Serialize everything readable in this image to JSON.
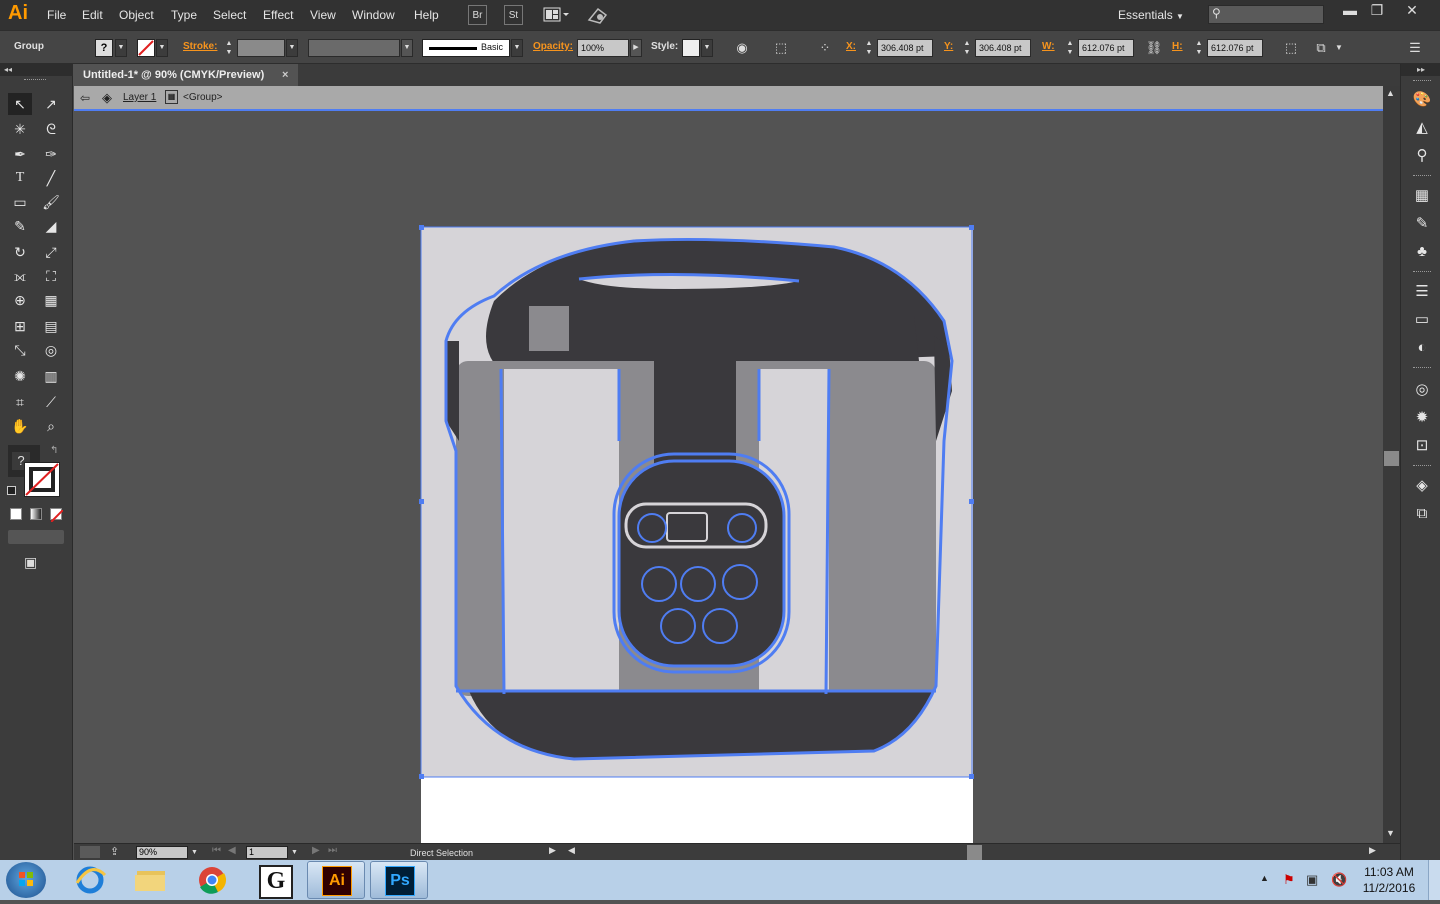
{
  "app": {
    "logo": "Ai"
  },
  "menu": [
    "File",
    "Edit",
    "Object",
    "Type",
    "Select",
    "Effect",
    "View",
    "Window",
    "Help"
  ],
  "menubar_buttons": {
    "bridge": "Br",
    "stock": "St"
  },
  "workspace": "Essentials",
  "control": {
    "selection_type": "Group",
    "stroke_label": "Stroke:",
    "brush_label": "Basic",
    "opacity_label": "Opacity:",
    "opacity_value": "100%",
    "style_label": "Style:",
    "x_label": "X:",
    "x_value": "306.408 pt",
    "y_label": "Y:",
    "y_value": "306.408 pt",
    "w_label": "W:",
    "w_value": "612.076 pt",
    "h_label": "H:",
    "h_value": "612.076 pt"
  },
  "document": {
    "tab_title": "Untitled-1* @ 90% (CMYK/Preview)",
    "layer": "Layer 1",
    "group": "<Group>"
  },
  "status": {
    "zoom": "90%",
    "artboard": "1",
    "tool": "Direct Selection"
  },
  "taskbar": {
    "time": "11:03 AM",
    "date": "11/2/2016"
  },
  "colors": {
    "accent": "#4f7df2",
    "orange": "#f7941d",
    "artboard": "#d6d4d8",
    "dark_fill": "#3a393d",
    "mid_fill": "#8b8a8e",
    "light_fill": "#d6d4d8"
  }
}
